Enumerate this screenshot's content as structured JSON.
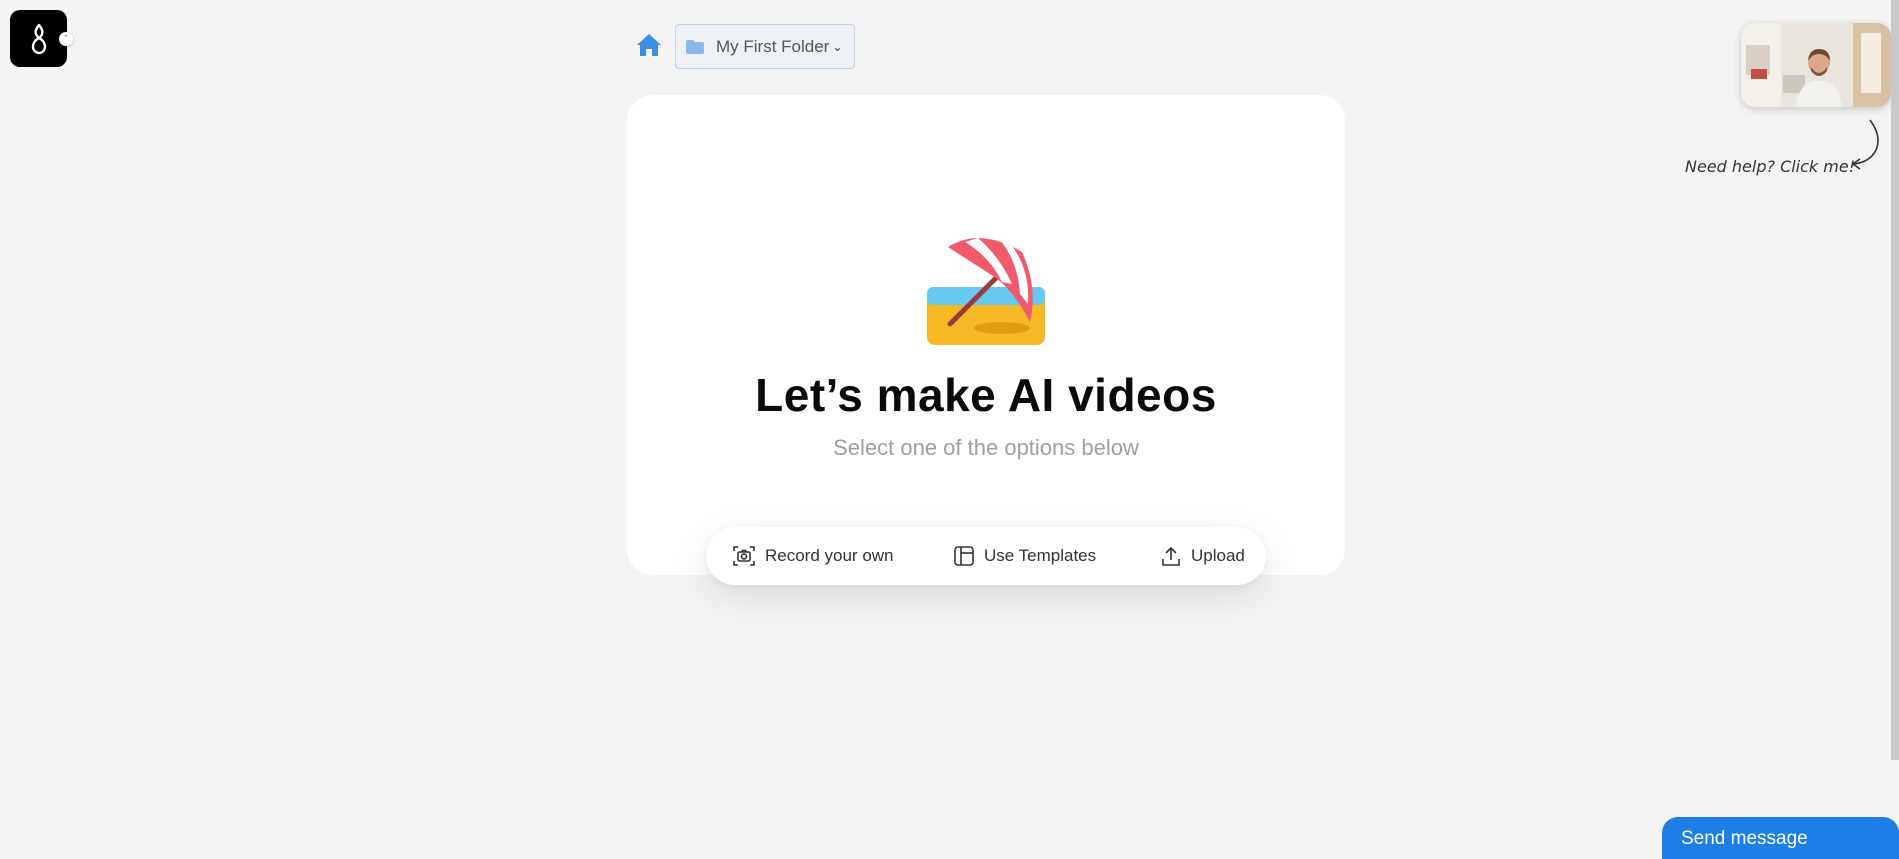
{
  "app": {
    "logo_icon": "logo-icon"
  },
  "breadcrumb": {
    "home_icon": "home-icon",
    "folder_icon": "folder-icon",
    "folder_label": "My First Folder",
    "chevron_icon": "chevron-down-icon"
  },
  "main": {
    "title": "Let’s make AI videos",
    "subtitle": "Select one of the options below",
    "illustration": "beach-umbrella-icon",
    "options": [
      {
        "label": "Record your own",
        "icon": "camera-icon"
      },
      {
        "label": "Use Templates",
        "icon": "template-icon"
      },
      {
        "label": "Upload",
        "icon": "upload-icon"
      }
    ]
  },
  "help": {
    "text": "Need help? Click me!",
    "video_icon": "presenter-video-thumbnail"
  },
  "chat": {
    "send_label": "Send message"
  },
  "colors": {
    "accent": "#1d7fe6",
    "home_icon": "#3b8fe0",
    "folder_icon": "#8ab8e8",
    "page_bg": "#f4f4f4"
  }
}
